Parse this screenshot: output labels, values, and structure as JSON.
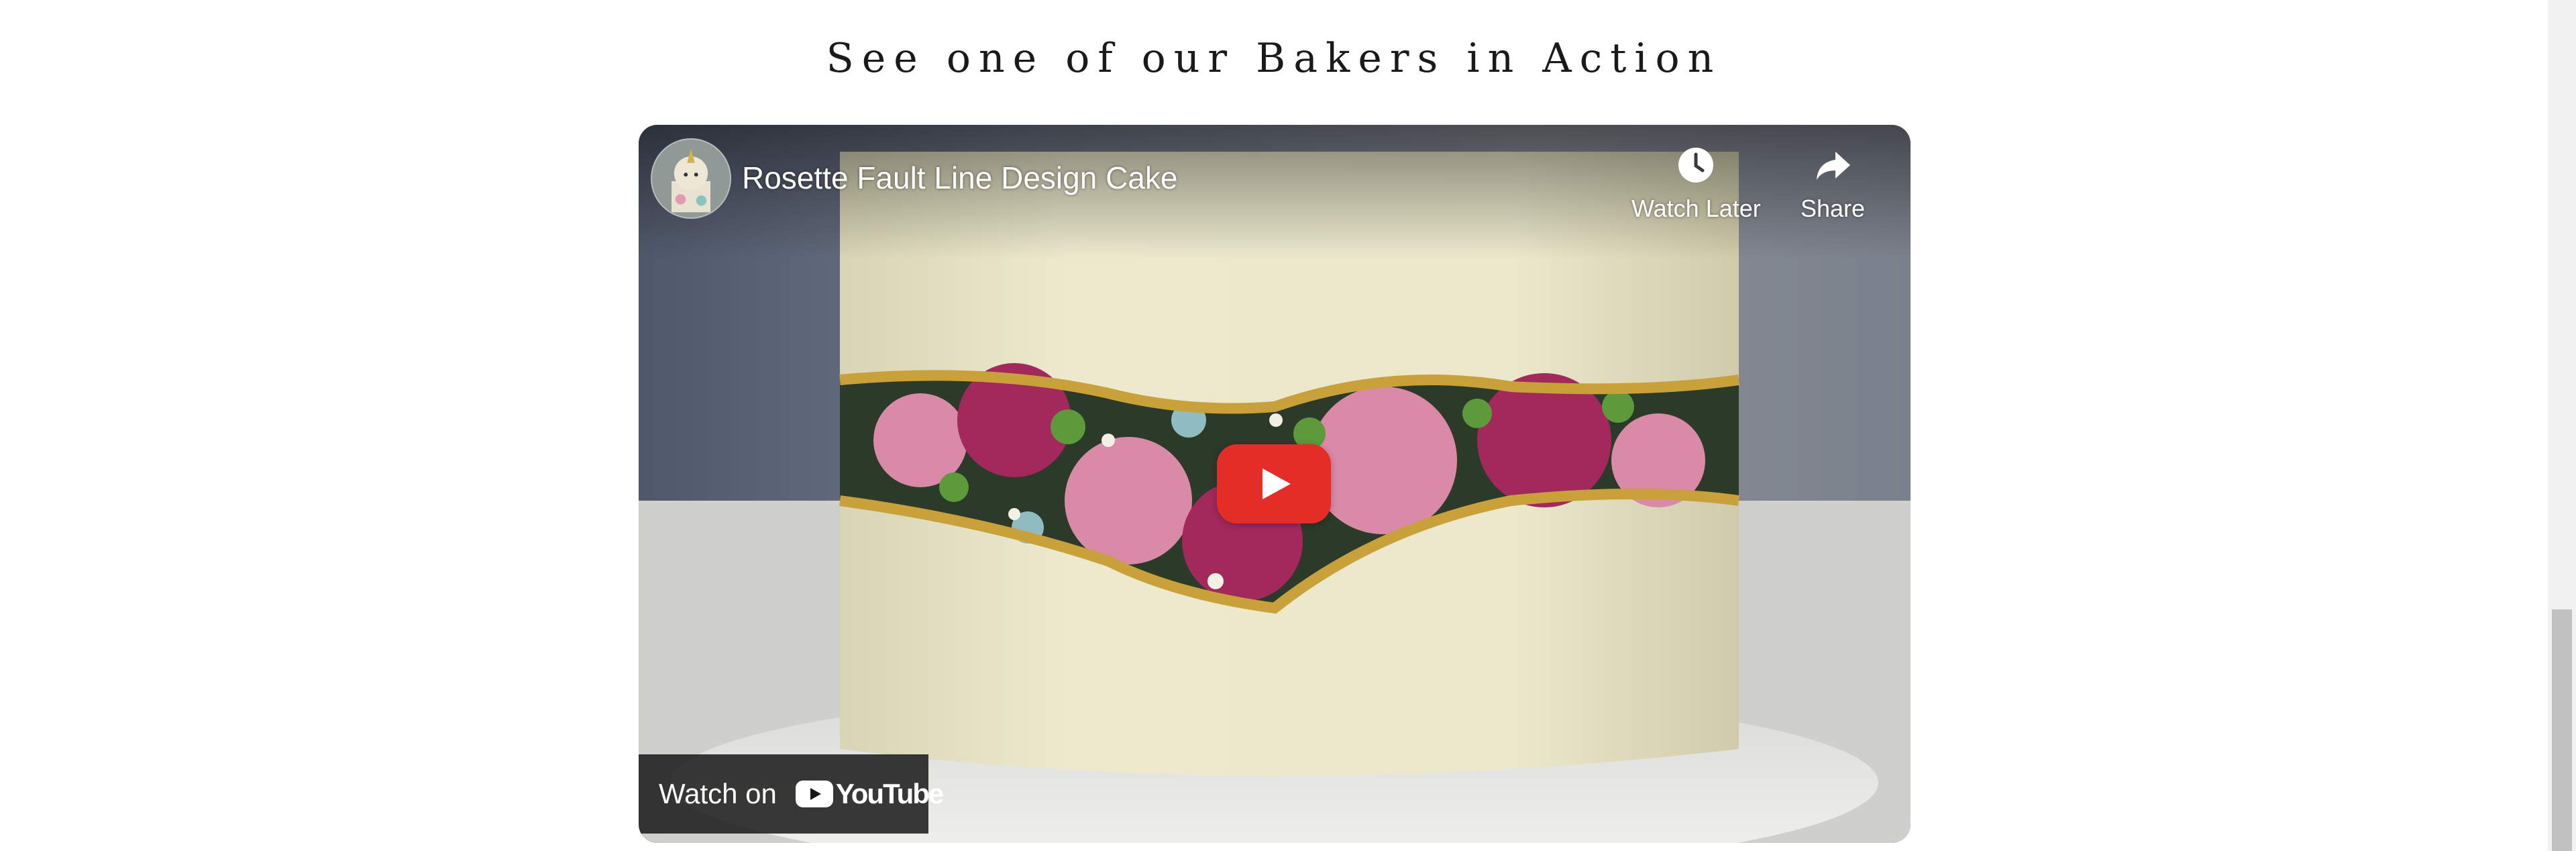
{
  "section": {
    "heading": "See one of our Bakers in Action"
  },
  "video": {
    "title": "Rosette Fault Line Design Cake",
    "channel_avatar_icon": "unicorn-cake-avatar",
    "controls": {
      "watch_later_label": "Watch Later",
      "watch_later_icon": "clock-icon",
      "share_label": "Share",
      "share_icon": "share-arrow-icon"
    },
    "play_button_icon": "play-icon",
    "watch_on_label": "Watch on",
    "platform_wordmark": "YouTube",
    "colors": {
      "play_button": "#e52d27",
      "cake_frosting": "#e9e6c8",
      "gold_edge": "#c9a13a",
      "pink_rosette": "#d98aa6",
      "magenta_rosette": "#a3285c"
    }
  }
}
